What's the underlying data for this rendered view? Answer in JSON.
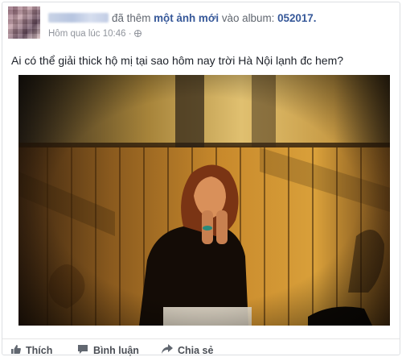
{
  "post": {
    "author_blurred": "",
    "action_text": "đã thêm",
    "object_link": "một ảnh mới",
    "middle_text": "vào album:",
    "album_link": "052017.",
    "timestamp": "Hôm qua lúc 10:46 ·",
    "privacy_icon": "globe-icon",
    "caption": "Ai có thể giải thick hộ mị tại sao hôm nay trời Hà Nội lạnh đc hem?"
  },
  "actions": {
    "like_label": "Thích",
    "comment_label": "Bình luận",
    "share_label": "Chia sẻ"
  },
  "colors": {
    "link": "#365899",
    "secondary": "#90949c",
    "action": "#4b4f56"
  }
}
